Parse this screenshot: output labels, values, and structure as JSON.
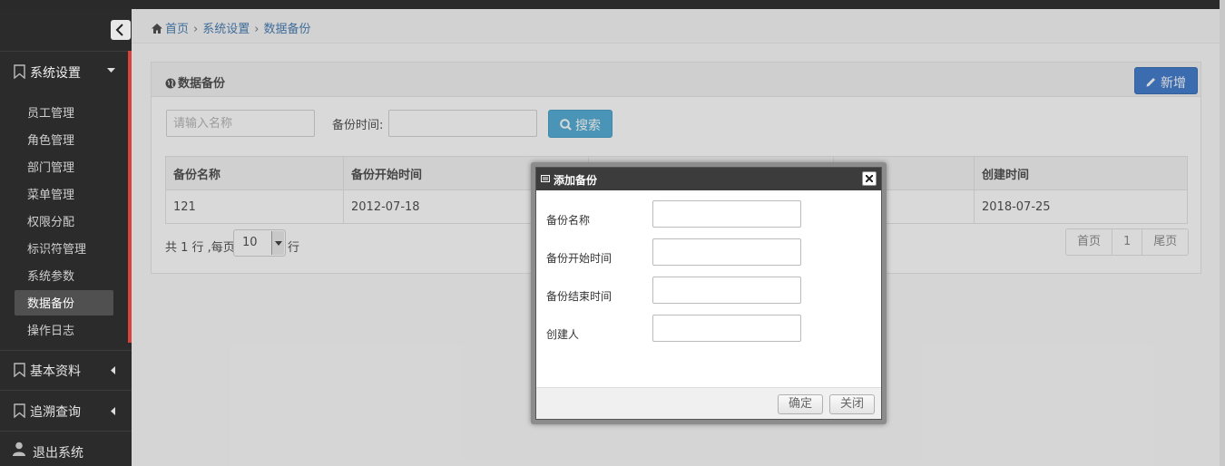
{
  "sidebar": {
    "groups": [
      {
        "label": "系统设置",
        "open": true
      },
      {
        "label": "基本资料",
        "open": false
      },
      {
        "label": "追溯查询",
        "open": false
      }
    ],
    "items": [
      "员工管理",
      "角色管理",
      "部门管理",
      "菜单管理",
      "权限分配",
      "标识符管理",
      "系统参数",
      "数据备份",
      "操作日志"
    ],
    "active_item": "数据备份",
    "logout_label": "退出系统"
  },
  "breadcrumb": [
    "首页",
    "系统设置",
    "数据备份"
  ],
  "panel": {
    "title": "数据备份",
    "add_label": "新增"
  },
  "search": {
    "name_placeholder": "请输入名称",
    "time_label": "备份时间:",
    "search_label": "搜索"
  },
  "table": {
    "columns": [
      "备份名称",
      "备份开始时间",
      "",
      "",
      "创建时间"
    ],
    "rows": [
      [
        "121",
        "2012-07-18",
        "",
        "",
        "2018-07-25"
      ]
    ]
  },
  "pagination": {
    "total_prefix": "共 1 行 ,每页",
    "page_size": "10",
    "rows_suffix": "行",
    "first_label": "首页",
    "current_page": "1",
    "last_label": "尾页"
  },
  "dialog": {
    "title": "添加备份",
    "fields": [
      "备份名称",
      "备份开始时间",
      "备份结束时间",
      "创建人"
    ],
    "confirm_label": "确定",
    "close_label": "关闭"
  },
  "colors": {
    "sidebar_bg": "#2b2b2b",
    "accent_red": "#d9443a",
    "primary_blue": "#2468c6",
    "search_blue": "#3aa1d0",
    "link_blue": "#2a6aa8"
  }
}
